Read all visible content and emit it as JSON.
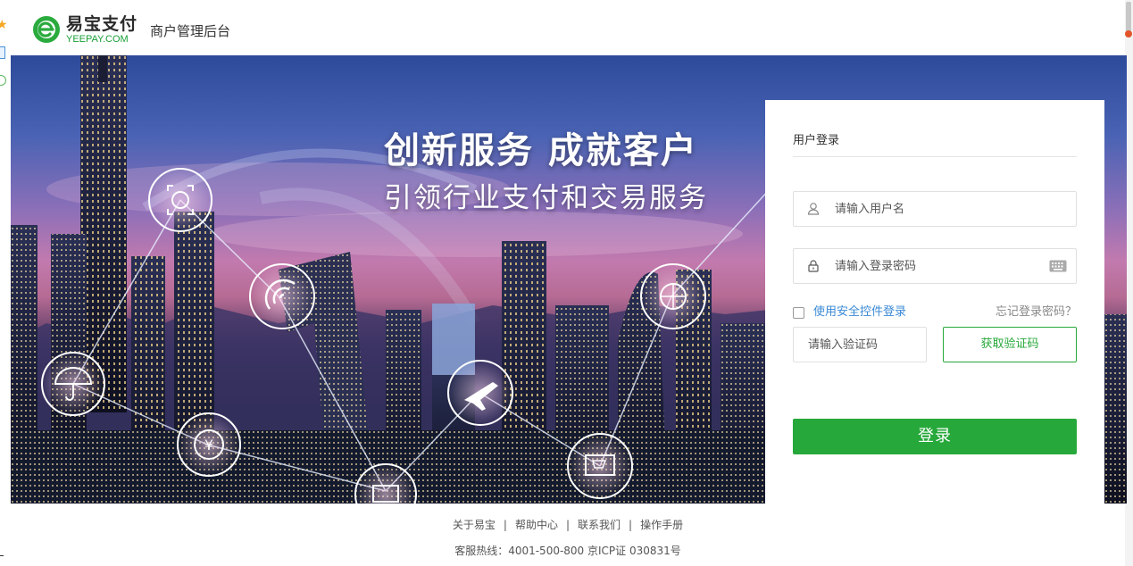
{
  "header": {
    "logo_cn": "易宝支付",
    "logo_en": "YEEPAY.COM",
    "title": "商户管理后台"
  },
  "banner": {
    "headline": "创新服务 成就客户",
    "subline": "引领行业支付和交易服务",
    "icons": [
      "face-scan-icon",
      "nfc-pay-icon",
      "umbrella-icon",
      "yuan-coin-icon",
      "airplane-icon",
      "shopping-cart-icon",
      "global-currency-icon",
      "suitcase-icon"
    ]
  },
  "login": {
    "title": "用户登录",
    "username_placeholder": "请输入用户名",
    "password_placeholder": "请输入登录密码",
    "safe_control_label": "使用安全控件登录",
    "forgot_label": "忘记登录密码？",
    "captcha_placeholder": "请输入验证码",
    "get_code_label": "获取验证码",
    "submit_label": "登录"
  },
  "footer": {
    "links": [
      "关于易宝",
      "帮助中心",
      "联系我们",
      "操作手册"
    ],
    "info": "客服热线：4001-500-800 京ICP证 030831号"
  },
  "colors": {
    "brand_green": "#26a83a",
    "link_blue": "#3a8ad6"
  }
}
